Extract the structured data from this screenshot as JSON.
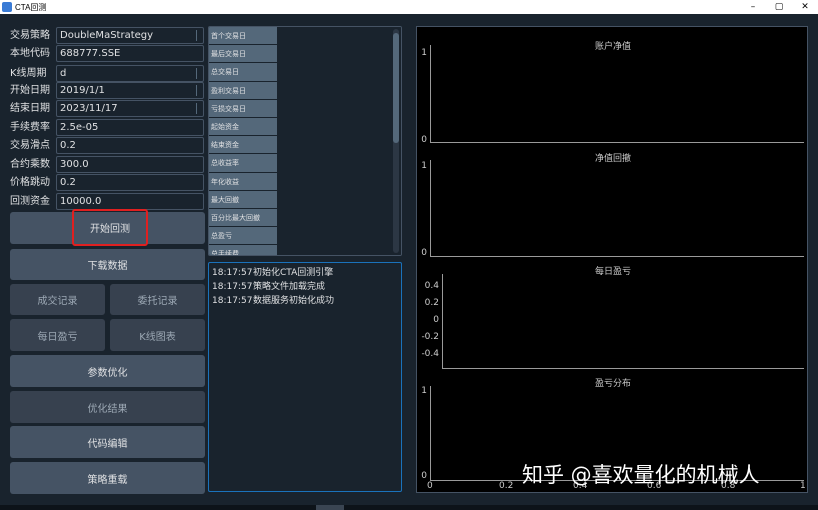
{
  "window": {
    "title": "CTA回测",
    "minimize": "–",
    "maximize": "▢",
    "close": "✕"
  },
  "params": [
    {
      "label": "交易策略",
      "value": "DoubleMaStrategy",
      "combo": true
    },
    {
      "label": "本地代码",
      "value": "688777.SSE",
      "combo": false
    },
    {
      "label": "K线周期",
      "value": "d",
      "combo": true
    },
    {
      "label": "开始日期",
      "value": "2019/1/1",
      "combo": true
    },
    {
      "label": "结束日期",
      "value": "2023/11/17",
      "combo": true
    },
    {
      "label": "手续费率",
      "value": "2.5e-05",
      "combo": false
    },
    {
      "label": "交易滑点",
      "value": "0.2",
      "combo": false
    },
    {
      "label": "合约乘数",
      "value": "300.0",
      "combo": false
    },
    {
      "label": "价格跳动",
      "value": "0.2",
      "combo": false
    },
    {
      "label": "回测资金",
      "value": "10000.0",
      "combo": false
    }
  ],
  "buttons": {
    "start_backtest": "开始回测",
    "download_data": "下载数据",
    "trade_records": "成交记录",
    "order_records": "委托记录",
    "daily_pnl": "每日盈亏",
    "kline_chart": "K线图表",
    "param_optimize": "参数优化",
    "optimize_result": "优化结果",
    "code_edit": "代码编辑",
    "strategy_reload": "策略重载"
  },
  "stats": [
    "首个交易日",
    "最后交易日",
    "总交易日",
    "盈利交易日",
    "亏损交易日",
    "起始资金",
    "结束资金",
    "总收益率",
    "年化收益",
    "最大回撤",
    "百分比最大回撤",
    "总盈亏",
    "总手续费"
  ],
  "log": [
    {
      "time": "18:17:57",
      "msg": "初始化CTA回测引擎"
    },
    {
      "time": "18:17:57",
      "msg": "策略文件加载完成"
    },
    {
      "time": "18:17:57",
      "msg": "数据服务初始化成功"
    }
  ],
  "charts": [
    {
      "title": "账户净值",
      "yticks": [
        "1",
        "0"
      ]
    },
    {
      "title": "净值回撤",
      "yticks": [
        "1",
        "0"
      ]
    },
    {
      "title": "每日盈亏",
      "yticks": [
        "0.4",
        "0.2",
        "0",
        "-0.2",
        "-0.4"
      ]
    },
    {
      "title": "盈亏分布",
      "yticks": [
        "1",
        "0"
      ],
      "xticks": [
        "0",
        "0.2",
        "0.4",
        "0.6",
        "0.8",
        "1"
      ]
    }
  ],
  "watermark": "知乎 @喜欢量化的机械人"
}
